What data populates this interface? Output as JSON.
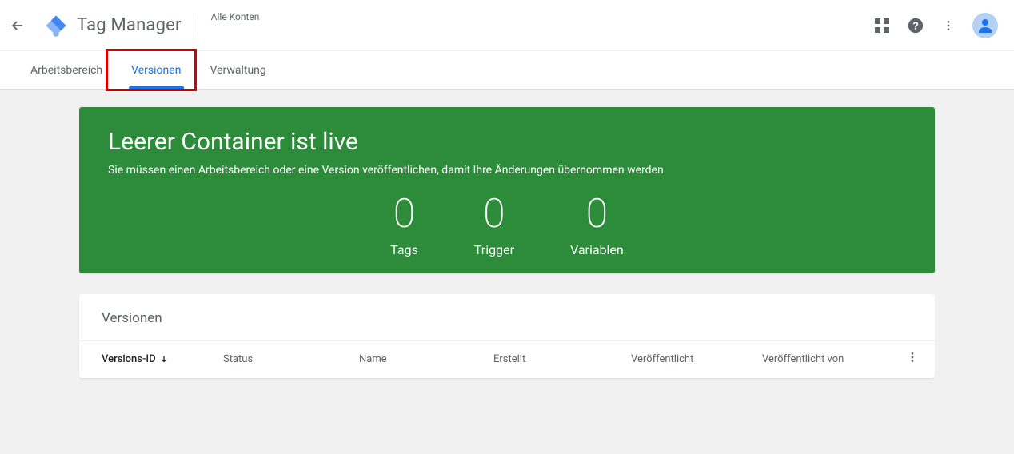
{
  "header": {
    "product_name": "Tag Manager",
    "breadcrumb": "Alle Konten"
  },
  "tabs": {
    "workspace": "Arbeitsbereich",
    "versions": "Versionen",
    "admin": "Verwaltung"
  },
  "hero": {
    "title": "Leerer Container ist live",
    "subtitle": "Sie müssen einen Arbeitsbereich oder eine Version veröffentlichen, damit Ihre Änderungen übernommen werden",
    "stats": {
      "tags": {
        "value": "0",
        "label": "Tags"
      },
      "triggers": {
        "value": "0",
        "label": "Trigger"
      },
      "variables": {
        "value": "0",
        "label": "Variablen"
      }
    }
  },
  "table": {
    "title": "Versionen",
    "columns": {
      "id": "Versions-ID",
      "status": "Status",
      "name": "Name",
      "created": "Erstellt",
      "published": "Veröffentlicht",
      "published_by": "Veröffentlicht von"
    }
  }
}
